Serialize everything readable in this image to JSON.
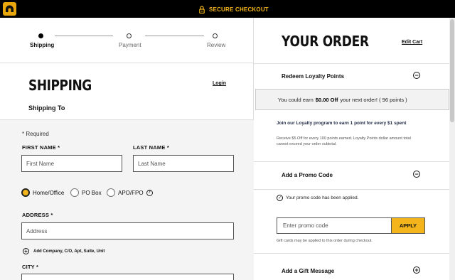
{
  "header": {
    "secure_checkout": "SECURE CHECKOUT",
    "brand_color": "#f3b51b"
  },
  "steps": [
    {
      "label": "Shipping",
      "active": true
    },
    {
      "label": "Payment",
      "active": false
    },
    {
      "label": "Review",
      "active": false
    }
  ],
  "shipping": {
    "title": "SHIPPING",
    "login": "Login",
    "ship_to": "Shipping To",
    "required_note": "* Required",
    "first_name_label": "FIRST NAME *",
    "first_name_placeholder": "First Name",
    "last_name_label": "LAST NAME *",
    "last_name_placeholder": "Last Name",
    "address_types": [
      "Home/Office",
      "PO Box",
      "APO/FPO"
    ],
    "selected_address_type": "Home/Office",
    "help_icon": "?",
    "address_label": "ADDRESS *",
    "address_placeholder": "Address",
    "add_company": "Add Company, C/O, Apt, Suite, Unit",
    "city_label": "CITY *"
  },
  "order": {
    "title": "YOUR ORDER",
    "edit_cart": "Edit Cart",
    "loyalty_title": "Redeem Loyalty Points",
    "earn_prefix": "You could earn",
    "earn_amount": "$0.00 Off",
    "earn_suffix": "your next order! ( 96 points )",
    "join_text": "Join our Loyalty program to earn 1 point for every $1 spent",
    "receive_text": "Receive $5 Off for every 100 points earned. Loyalty Points dollar amount total cannot exceed your order subtotal.",
    "promo_title": "Add a Promo Code",
    "promo_applied": "Your promo code has been applied.",
    "promo_placeholder": "Enter promo code",
    "apply_label": "APPLY",
    "gift_card_note": "Gift cards may be applied to this order during checkout.",
    "gift_message_title": "Add a Gift Message"
  }
}
